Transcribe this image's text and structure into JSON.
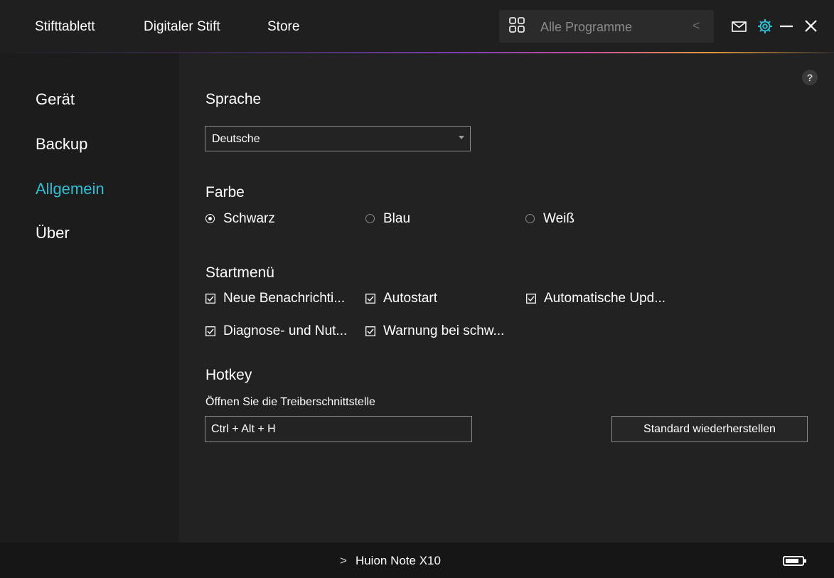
{
  "header": {
    "tabs": [
      {
        "label": "Stifttablett"
      },
      {
        "label": "Digitaler Stift"
      },
      {
        "label": "Store"
      }
    ],
    "program_selector": {
      "label": "Alle Programme",
      "icon": "grid-icon",
      "arrow": "<"
    },
    "icons": [
      "mail-icon",
      "gear-icon",
      "minimize-icon",
      "close-icon"
    ],
    "accent_color": "#2fbfd4"
  },
  "sidebar": {
    "items": [
      {
        "label": "Gerät",
        "active": false
      },
      {
        "label": "Backup",
        "active": false
      },
      {
        "label": "Allgemein",
        "active": true
      },
      {
        "label": "Über",
        "active": false
      }
    ]
  },
  "main": {
    "help_label": "?",
    "language": {
      "title": "Sprache",
      "selected": "Deutsche"
    },
    "color": {
      "title": "Farbe",
      "options": [
        {
          "label": "Schwarz",
          "selected": true
        },
        {
          "label": "Blau",
          "selected": false
        },
        {
          "label": "Weiß",
          "selected": false
        }
      ]
    },
    "startmenu": {
      "title": "Startmenü",
      "options": [
        {
          "label": "Neue Benachrichti...",
          "checked": true
        },
        {
          "label": "Autostart",
          "checked": true
        },
        {
          "label": "Automatische Upd...",
          "checked": true
        },
        {
          "label": "Diagnose- und Nut...",
          "checked": true
        },
        {
          "label": "Warnung bei schw...",
          "checked": true
        }
      ]
    },
    "hotkey": {
      "title": "Hotkey",
      "subtitle": "Öffnen Sie die Treiberschnittstelle",
      "value": "Ctrl + Alt + H",
      "reset_label": "Standard wiederherstellen"
    }
  },
  "footer": {
    "device_chevron": ">",
    "device_name": "Huion Note X10",
    "battery_icon": "battery-icon"
  }
}
